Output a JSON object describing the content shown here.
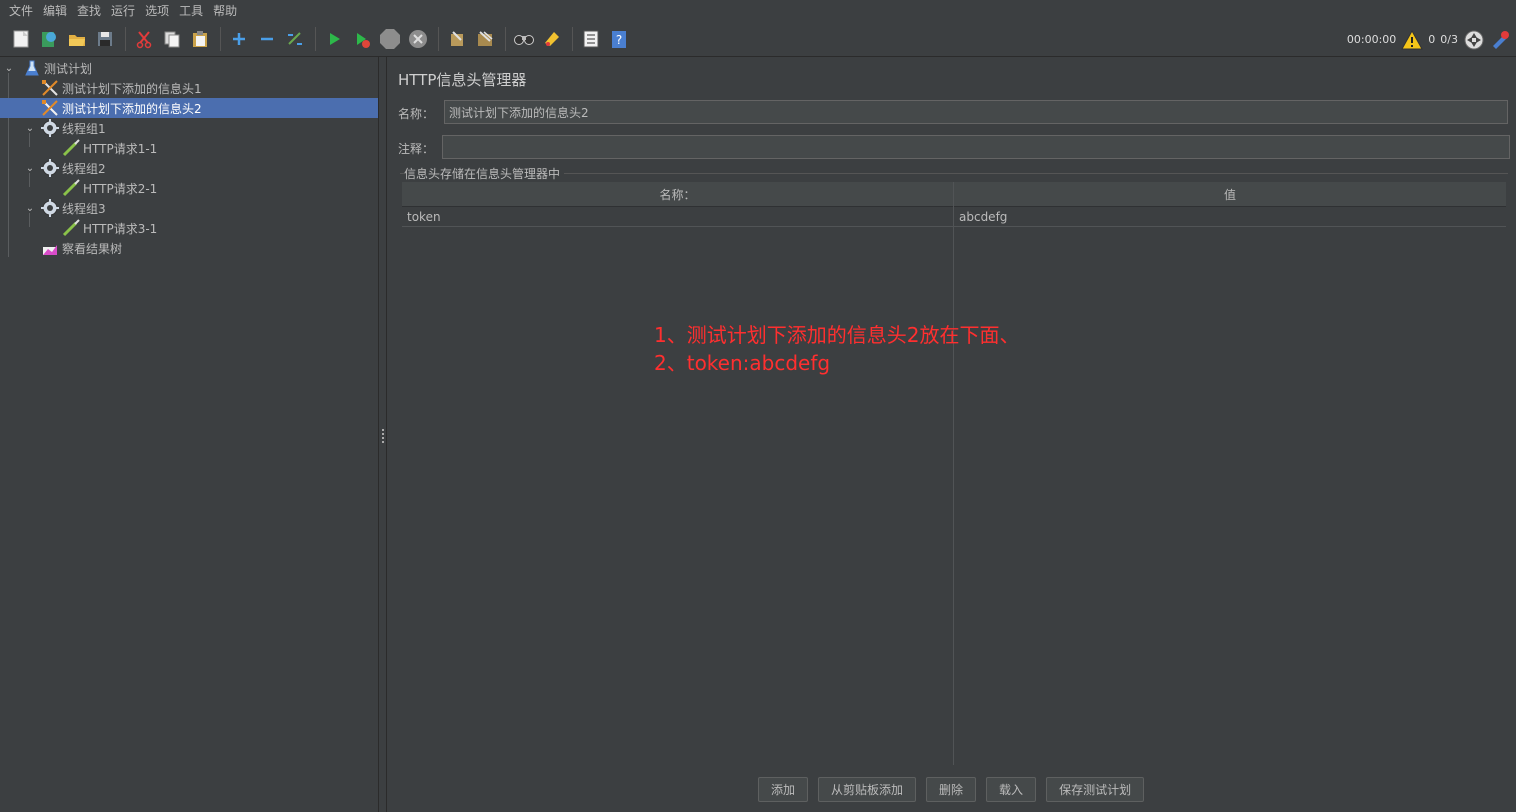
{
  "menu": [
    "文件",
    "编辑",
    "查找",
    "运行",
    "选项",
    "工具",
    "帮助"
  ],
  "toolbar": {
    "icons": [
      "new-icon",
      "templates-icon",
      "open-icon",
      "save-icon",
      "cut-icon",
      "copy-icon",
      "paste-icon",
      "expand-icon",
      "collapse-icon",
      "toggle-icon",
      "start-icon",
      "start-no-pause-icon",
      "stop-icon",
      "shutdown-icon",
      "clear-icon",
      "clear-all-icon",
      "search-icon",
      "reset-search-icon",
      "function-helper-icon",
      "help-icon"
    ],
    "timer": "00:00:00",
    "warning_count": "0",
    "threads": "0/3"
  },
  "tree": {
    "items": [
      {
        "label": "测试计划",
        "icon": "test-plan-icon",
        "level": 0,
        "expanded": true
      },
      {
        "label": "测试计划下添加的信息头1",
        "icon": "header-manager-icon",
        "level": 1
      },
      {
        "label": "测试计划下添加的信息头2",
        "icon": "header-manager-icon",
        "level": 1,
        "selected": true
      },
      {
        "label": "线程组1",
        "icon": "thread-group-icon",
        "level": 1,
        "expanded": true
      },
      {
        "label": "HTTP请求1-1",
        "icon": "http-sampler-icon",
        "level": 2
      },
      {
        "label": "线程组2",
        "icon": "thread-group-icon",
        "level": 1,
        "expanded": true
      },
      {
        "label": "HTTP请求2-1",
        "icon": "http-sampler-icon",
        "level": 2
      },
      {
        "label": "线程组3",
        "icon": "thread-group-icon",
        "level": 1,
        "expanded": true
      },
      {
        "label": "HTTP请求3-1",
        "icon": "http-sampler-icon",
        "level": 2
      },
      {
        "label": "察看结果树",
        "icon": "result-tree-icon",
        "level": 1
      }
    ]
  },
  "panel": {
    "title": "HTTP信息头管理器",
    "name_label": "名称：",
    "name_value": "测试计划下添加的信息头2",
    "comment_label": "注释：",
    "comment_value": "",
    "group_title": "信息头存储在信息头管理器中",
    "table": {
      "headers": [
        "名称：",
        "值"
      ],
      "rows": [
        [
          "token",
          "abcdefg"
        ]
      ]
    },
    "annotation": [
      "1、测试计划下添加的信息头2放在下面、",
      "2、token:abcdefg"
    ],
    "buttons": [
      "添加",
      "从剪贴板添加",
      "删除",
      "载入",
      "保存测试计划"
    ]
  },
  "colors": {
    "background": "#3c3f41",
    "selection": "#4b6eaf",
    "annotation": "#ff2f2f"
  }
}
